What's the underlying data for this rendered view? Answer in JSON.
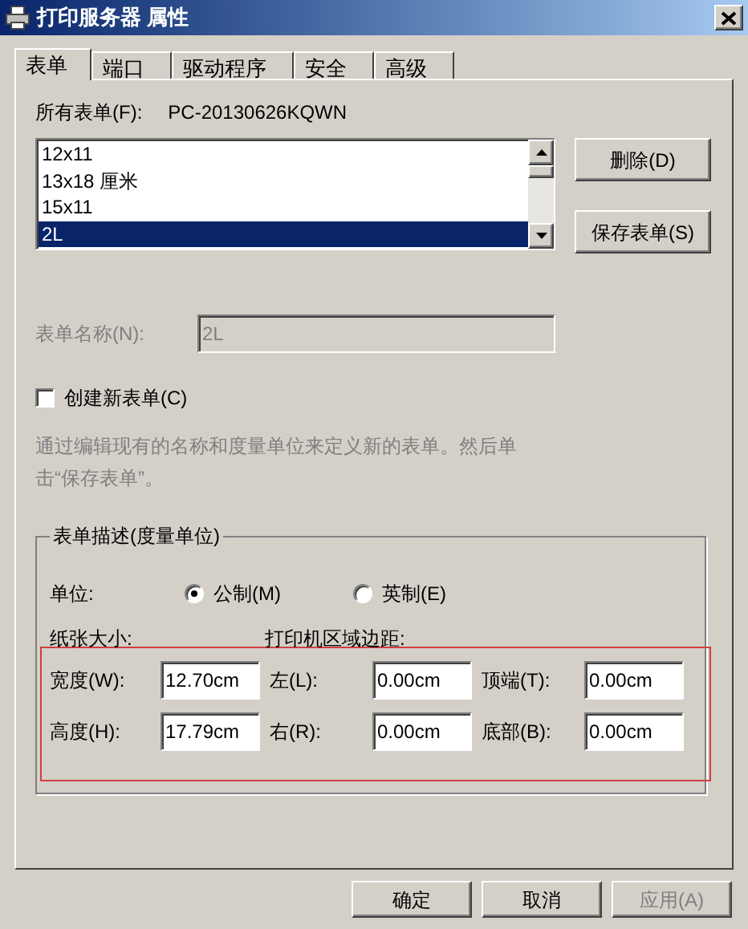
{
  "window": {
    "title": "打印服务器 属性"
  },
  "tabs": [
    {
      "label": "表单",
      "selected": true
    },
    {
      "label": "端口",
      "selected": false
    },
    {
      "label": "驱动程序",
      "selected": false
    },
    {
      "label": "安全",
      "selected": false
    },
    {
      "label": "高级",
      "selected": false
    }
  ],
  "forms": {
    "label": "所有表单(F):",
    "server": "PC-20130626KQWN",
    "items": [
      {
        "label": "12x11",
        "selected": false
      },
      {
        "label": "13x18 厘米",
        "selected": false
      },
      {
        "label": "15x11",
        "selected": false
      },
      {
        "label": "2L",
        "selected": true
      }
    ],
    "buttons": [
      "删除(D)",
      "保存表单(S)"
    ]
  },
  "form_name": {
    "label": "表单名称(N):",
    "value": "2L",
    "disabled": true
  },
  "create_new": {
    "label": "创建新表单(C)",
    "checked": false
  },
  "description": {
    "text": "通过编辑现有的名称和度量单位来定义新的表单。然后单击“保存表单”。",
    "disabled": true
  },
  "measurements": {
    "title": "表单描述(度量单位)",
    "units_label": "单位:",
    "units": [
      {
        "label": "公制(M)",
        "selected": true
      },
      {
        "label": "英制(E)",
        "selected": false
      }
    ],
    "paper_size_label": "纸张大小:",
    "margins_label": "打印机区域边距:",
    "rows": [
      [
        {
          "label": "宽度(W):",
          "value": "12.70cm"
        },
        {
          "label": "左(L):",
          "value": "0.00cm"
        },
        {
          "label": "顶端(T):",
          "value": "0.00cm"
        }
      ],
      [
        {
          "label": "高度(H):",
          "value": "17.79cm"
        },
        {
          "label": "右(R):",
          "value": "0.00cm"
        },
        {
          "label": "底部(B):",
          "value": "0.00cm"
        }
      ]
    ]
  },
  "buttons": [
    {
      "label": "确定",
      "disabled": false
    },
    {
      "label": "取消",
      "disabled": false
    },
    {
      "label": "应用(A)",
      "disabled": true
    }
  ]
}
